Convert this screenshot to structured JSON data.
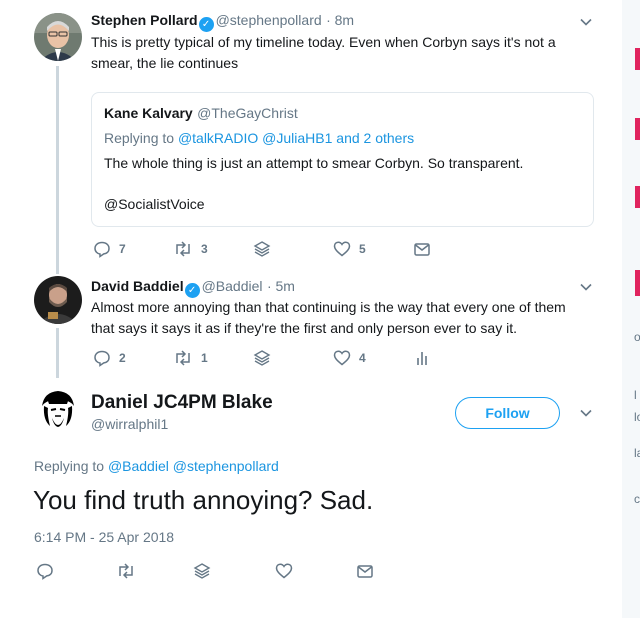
{
  "tweets": [
    {
      "name": "Stephen Pollard",
      "handle": "@stephenpollard",
      "time": "· 8m",
      "text_line1": "This is pretty typical of my timeline today. Even when Corbyn says it's not a",
      "text_line2": "smear, the lie continues",
      "verified": true,
      "actions": {
        "reply": "7",
        "retweet": "3",
        "like": "5"
      }
    },
    {
      "name": "David Baddiel",
      "handle": "@Baddiel",
      "time": "· 5m",
      "text_line1": "Almost more annoying than that continuing is the way that every one of them",
      "text_line2": "that says it says it as if they're the first and only person ever to say it.",
      "verified": true,
      "actions": {
        "reply": "2",
        "retweet": "1",
        "like": "4"
      }
    }
  ],
  "quoted": {
    "name": "Kane Kalvary",
    "handle": "@TheGayChrist",
    "replying_prefix": "Replying to ",
    "replying_users": "@talkRADIO @JuliaHB1",
    "replying_suffix": " and 2 others",
    "text": "The whole thing is just an attempt to smear Corbyn. So transparent.",
    "mention": "@SocialistVoice"
  },
  "main_tweet": {
    "name": "Daniel JC4PM Blake",
    "handle": "@wirralphil1",
    "follow_label": "Follow",
    "replying_prefix": "Replying to ",
    "replying_users": "@Baddiel @stephenpollard",
    "text": "You find truth annoying? Sad.",
    "timestamp": "6:14 PM - 25 Apr 2018"
  },
  "right_strip": {
    "fragments": [
      "o",
      "l",
      "lo",
      "la",
      "c"
    ]
  },
  "colors": {
    "accent": "#1da1f2",
    "muted": "#657786",
    "link": "#1b95e0",
    "border": "#e1e8ed",
    "thread": "#ccd6dd"
  }
}
